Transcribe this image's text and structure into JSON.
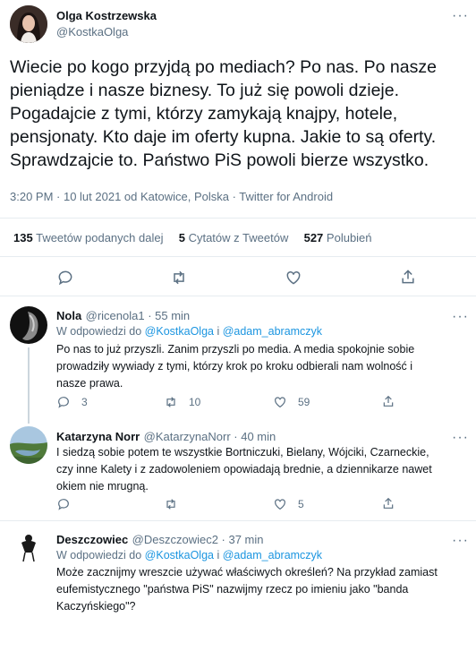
{
  "main_tweet": {
    "author_name": "Olga Kostrzewska",
    "author_handle": "@KostkaOlga",
    "text_lines": [
      "Wiecie po kogo przyjdą po mediach? Po nas. Po nasze",
      "pieniądze i nasze biznesy. To już się powoli dzieje.",
      "Pogadajcie z tymi, którzy zamykają knajpy, hotele,",
      "pensjonaty. Kto daje im oferty kupna. Jakie to są oferty.",
      "Sprawdzajcie to. Państwo PiS powoli bierze wszystko."
    ],
    "meta": "3:20 PM · 10 lut 2021 od Katowice, Polska · Twitter for Android",
    "stats": {
      "retweets_count": "135",
      "retweets_label": "Tweetów podanych dalej",
      "quotes_count": "5",
      "quotes_label": "Cytatów z Tweetów",
      "likes_count": "527",
      "likes_label": "Polubień"
    }
  },
  "replies": [
    {
      "name": "Nola",
      "handle": "@ricenola1 · 55 min",
      "reply_prefix": "W odpowiedzi do ",
      "reply_to_1": "@KostkaOlga",
      "reply_and": " i ",
      "reply_to_2": "@adam_abramczyk",
      "text_lines": [
        "Po nas to już przyszli. Zanim przyszli po media. A media spokojnie sobie",
        "prowadziły wywiady z tymi, którzy krok po kroku odbierali nam wolność i",
        "nasze prawa."
      ],
      "replies_count": "3",
      "retweets_count": "10",
      "likes_count": "59"
    },
    {
      "name": "Katarzyna Norr",
      "handle": "@KatarzynaNorr · 40 min",
      "text_lines": [
        "I siedzą sobie potem te wszystkie Bortniczuki, Bielany, Wójciki, Czarneckie,",
        "czy inne Kalety i z zadowoleniem opowiadają brednie, a dziennikarze nawet",
        "okiem nie mrugną."
      ],
      "likes_count": "5"
    },
    {
      "name": "Deszczowiec",
      "handle": "@Deszczowiec2 · 37 min",
      "reply_prefix": "W odpowiedzi do ",
      "reply_to_1": "@KostkaOlga",
      "reply_and": " i ",
      "reply_to_2": "@adam_abramczyk",
      "text_lines": [
        "Może zacznijmy wreszcie używać właściwych określeń? Na przykład zamiast",
        "eufemistycznego \"państwa PiS\" nazwijmy rzecz po imieniu jako \"banda",
        "Kaczyńskiego\"?"
      ]
    }
  ],
  "colors": {
    "accent": "#1b95e0",
    "muted": "#5b7083",
    "text": "#0f1419",
    "divider": "#e6ecf0"
  }
}
